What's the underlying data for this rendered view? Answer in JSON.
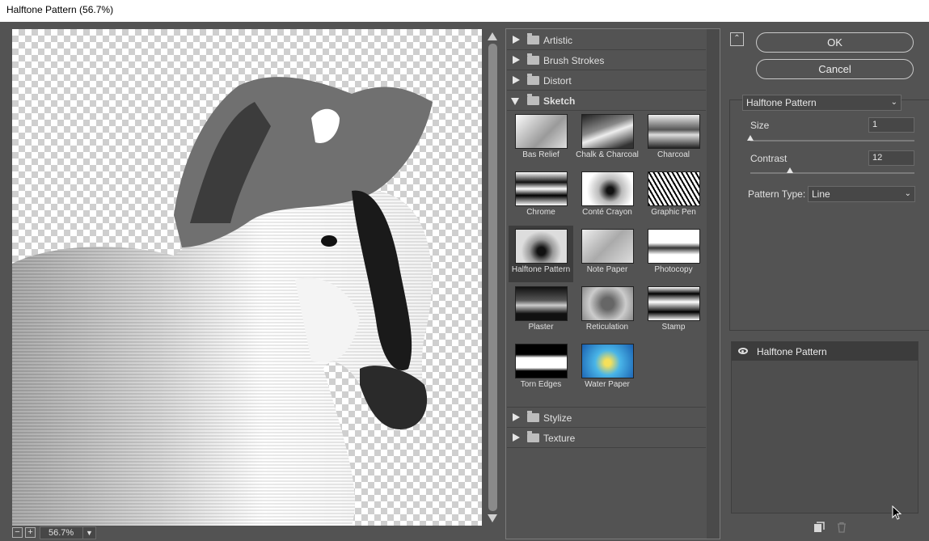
{
  "window": {
    "title": "Halftone Pattern (56.7%)"
  },
  "preview": {
    "zoom": "56.7%",
    "zoom_out": "−",
    "zoom_in": "+"
  },
  "gallery": {
    "categories_before": [
      {
        "label": "Artistic"
      },
      {
        "label": "Brush Strokes"
      },
      {
        "label": "Distort"
      }
    ],
    "open_category": {
      "label": "Sketch"
    },
    "filters": [
      {
        "label": "Bas Relief"
      },
      {
        "label": "Chalk & Charcoal"
      },
      {
        "label": "Charcoal"
      },
      {
        "label": "Chrome"
      },
      {
        "label": "Conté Crayon"
      },
      {
        "label": "Graphic Pen"
      },
      {
        "label": "Halftone Pattern"
      },
      {
        "label": "Note Paper"
      },
      {
        "label": "Photocopy"
      },
      {
        "label": "Plaster"
      },
      {
        "label": "Reticulation"
      },
      {
        "label": "Stamp"
      },
      {
        "label": "Torn Edges"
      },
      {
        "label": "Water Paper"
      }
    ],
    "selected_filter": "Halftone Pattern",
    "categories_after": [
      {
        "label": "Stylize"
      },
      {
        "label": "Texture"
      }
    ]
  },
  "controls": {
    "ok_label": "OK",
    "cancel_label": "Cancel",
    "filter_select": "Halftone Pattern",
    "size_label": "Size",
    "size_value": "1",
    "size_min": 1,
    "size_max": 12,
    "contrast_label": "Contrast",
    "contrast_value": "12",
    "contrast_min": 0,
    "contrast_max": 50,
    "pattern_type_label": "Pattern Type:",
    "pattern_type_value": "Line"
  },
  "layers": {
    "items": [
      {
        "label": "Halftone Pattern"
      }
    ]
  },
  "colors": {
    "panel": "#535353",
    "dark": "#3c3c3c",
    "accent": "#ffffff"
  }
}
